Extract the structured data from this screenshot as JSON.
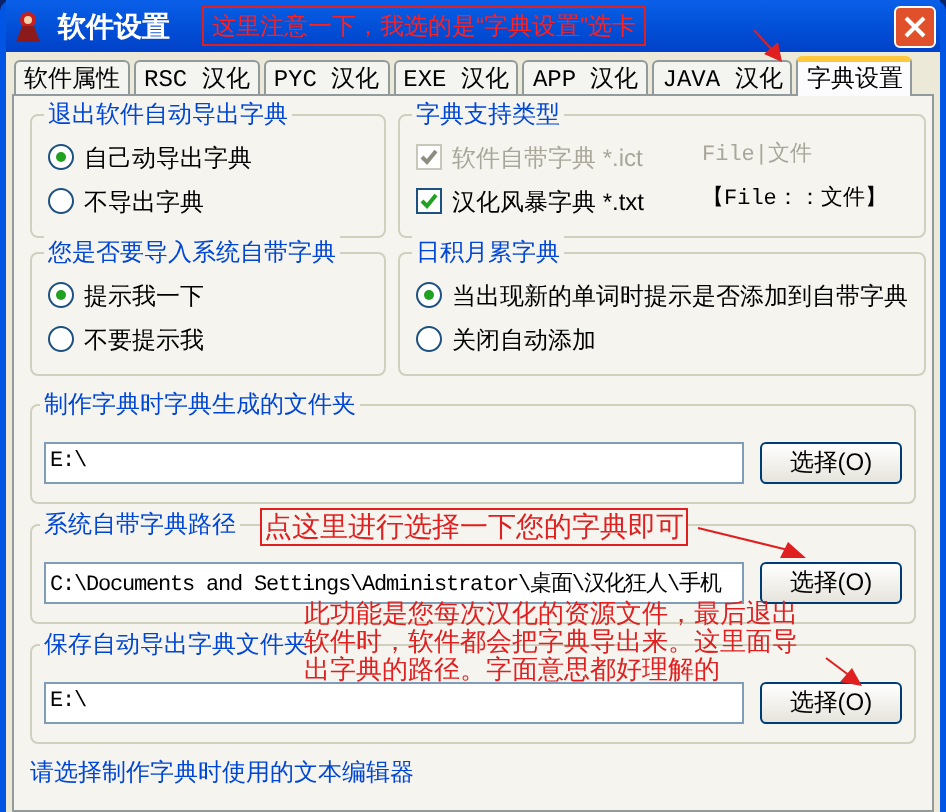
{
  "window": {
    "title": "软件设置",
    "annotation": "这里注意一下，我选的是“字典设置”选卡"
  },
  "tabs": [
    {
      "label": "软件属性",
      "selected": false
    },
    {
      "label": "RSC 汉化",
      "selected": false
    },
    {
      "label": "PYC 汉化",
      "selected": false
    },
    {
      "label": "EXE 汉化",
      "selected": false
    },
    {
      "label": "APP 汉化",
      "selected": false
    },
    {
      "label": "JAVA 汉化",
      "selected": false
    },
    {
      "label": "字典设置",
      "selected": true
    }
  ],
  "groups": [
    {
      "kind": "radio",
      "title": "退出软件自动导出字典",
      "options": [
        {
          "label": "自己动导出字典",
          "selected": true
        },
        {
          "label": "不导出字典",
          "selected": false
        }
      ]
    },
    {
      "kind": "check",
      "title": "字典支持类型",
      "options": [
        {
          "label": "软件自带字典 *.ict",
          "note": "File|文件",
          "checked": true,
          "disabled": true
        },
        {
          "label": "汉化风暴字典 *.txt",
          "note": "【File：：文件】",
          "checked": true,
          "disabled": false
        }
      ]
    },
    {
      "kind": "radio",
      "title": "您是否要导入系统自带字典",
      "options": [
        {
          "label": "提示我一下",
          "selected": true
        },
        {
          "label": "不要提示我",
          "selected": false
        }
      ]
    },
    {
      "kind": "radio",
      "title": "日积月累字典",
      "options": [
        {
          "label": "当出现新的单词时提示是否添加到自带字典",
          "selected": true
        },
        {
          "label": "关闭自动添加",
          "selected": false
        }
      ]
    }
  ],
  "paths": [
    {
      "title": "制作字典时字典生成的文件夹",
      "value": "E:\\",
      "button": "选择(O)"
    },
    {
      "title": "系统自带字典路径",
      "value": "C:\\Documents and Settings\\Administrator\\桌面\\汉化狂人\\手机",
      "button": "选择(O)"
    },
    {
      "title": "保存自动导出字典文件夹",
      "value": "E:\\",
      "button": "选择(O)"
    }
  ],
  "annotations": [
    "点这里进行选择一下您的字典即可",
    "此功能是您每次汉化的资源文件，最后退出软件时，软件都会把字典导出来。这里面导出字典的路径。字面意思都好理解的"
  ],
  "footer_label": "请选择制作字典时使用的文本编辑器"
}
